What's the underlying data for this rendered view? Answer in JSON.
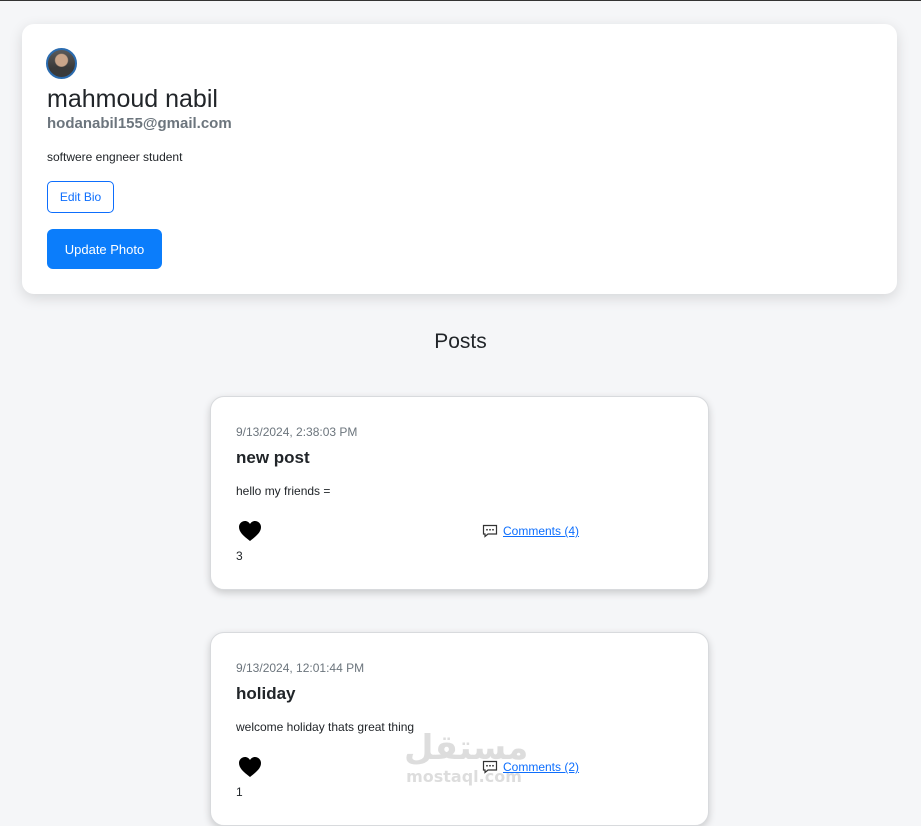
{
  "profile": {
    "name": "mahmoud nabil",
    "email": "hodanabil155@gmail.com",
    "bio": "softwere engneer student",
    "edit_bio_label": "Edit Bio",
    "update_photo_label": "Update Photo"
  },
  "posts_heading": "Posts",
  "posts": [
    {
      "date": "9/13/2024, 2:38:03 PM",
      "title": "new post",
      "body": "hello my friends =",
      "likes": "3",
      "comments_label": "Comments (4)"
    },
    {
      "date": "9/13/2024, 12:01:44 PM",
      "title": "holiday",
      "body": "welcome holiday thats great thing",
      "likes": "1",
      "comments_label": "Comments (2)"
    }
  ],
  "watermark": {
    "arabic": "مستقل",
    "latin": "mostaql.com"
  },
  "colors": {
    "primary": "#0b7dfb",
    "link": "#0d6efd",
    "background": "#f5f6f8",
    "card": "#ffffff"
  },
  "icons": {
    "like": "heart-icon",
    "comments": "comment-icon",
    "avatar": "profile-photo"
  }
}
